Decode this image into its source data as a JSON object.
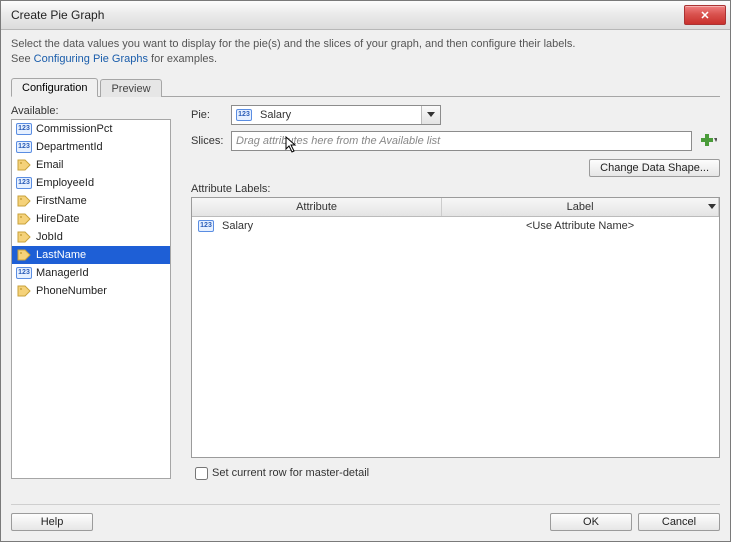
{
  "window": {
    "title": "Create Pie Graph"
  },
  "intro": {
    "line1": "Select the data values you want to display for the pie(s) and the slices of your graph, and then configure their labels.",
    "line2_prefix": "See ",
    "link": "Configuring Pie Graphs",
    "line2_suffix": " for examples."
  },
  "tabs": {
    "configuration": "Configuration",
    "preview": "Preview"
  },
  "available": {
    "label": "Available:",
    "items": [
      {
        "name": "CommissionPct",
        "icon": "num",
        "selected": false
      },
      {
        "name": "DepartmentId",
        "icon": "num",
        "selected": false
      },
      {
        "name": "Email",
        "icon": "tag",
        "selected": false
      },
      {
        "name": "EmployeeId",
        "icon": "num",
        "selected": false
      },
      {
        "name": "FirstName",
        "icon": "tag",
        "selected": false
      },
      {
        "name": "HireDate",
        "icon": "tag",
        "selected": false
      },
      {
        "name": "JobId",
        "icon": "tag",
        "selected": false
      },
      {
        "name": "LastName",
        "icon": "tag",
        "selected": true
      },
      {
        "name": "ManagerId",
        "icon": "num",
        "selected": false
      },
      {
        "name": "PhoneNumber",
        "icon": "tag",
        "selected": false
      }
    ]
  },
  "form": {
    "pie_label": "Pie:",
    "pie_value": "Salary",
    "slices_label": "Slices:",
    "slices_placeholder": "Drag attributes here from the Available list",
    "change_shape": "Change Data Shape...",
    "attr_labels": "Attribute Labels:",
    "col_attr": "Attribute",
    "col_label": "Label",
    "row1_attr": "Salary",
    "row1_label": "<Use Attribute Name>",
    "master_detail": "Set current row for master-detail"
  },
  "footer": {
    "help": "Help",
    "ok": "OK",
    "cancel": "Cancel"
  },
  "icons": {
    "num_text": "123"
  }
}
